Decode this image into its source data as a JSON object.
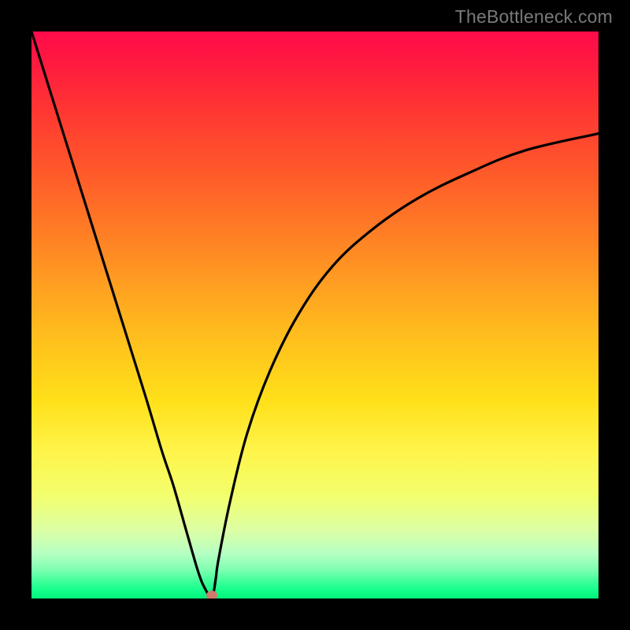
{
  "attribution": "TheBottleneck.com",
  "chart_data": {
    "type": "line",
    "title": "",
    "xlabel": "",
    "ylabel": "",
    "xrange": [
      0,
      100
    ],
    "yrange": [
      0,
      100
    ],
    "series": [
      {
        "name": "bottleneck-curve",
        "x": [
          0,
          5,
          10,
          15,
          20,
          23,
          25,
          27,
          29,
          30,
          31,
          31.5,
          32,
          32.5,
          33,
          35,
          38,
          42,
          47,
          53,
          60,
          68,
          77,
          87,
          100
        ],
        "values": [
          100,
          84,
          68,
          52,
          36,
          26,
          20,
          13,
          6,
          3,
          1,
          0,
          0.5,
          3.5,
          7,
          17,
          29,
          40,
          50,
          58.5,
          65,
          70.5,
          75,
          79,
          82
        ]
      }
    ],
    "marker": {
      "x": 31.8,
      "y": 0.5
    },
    "colors": {
      "background_top": "#ff0b4a",
      "background_bottom": "#00f27a",
      "line": "#000000",
      "marker": "#cf7a6a",
      "frame": "#000000",
      "attribution": "#7a7a7a"
    }
  }
}
